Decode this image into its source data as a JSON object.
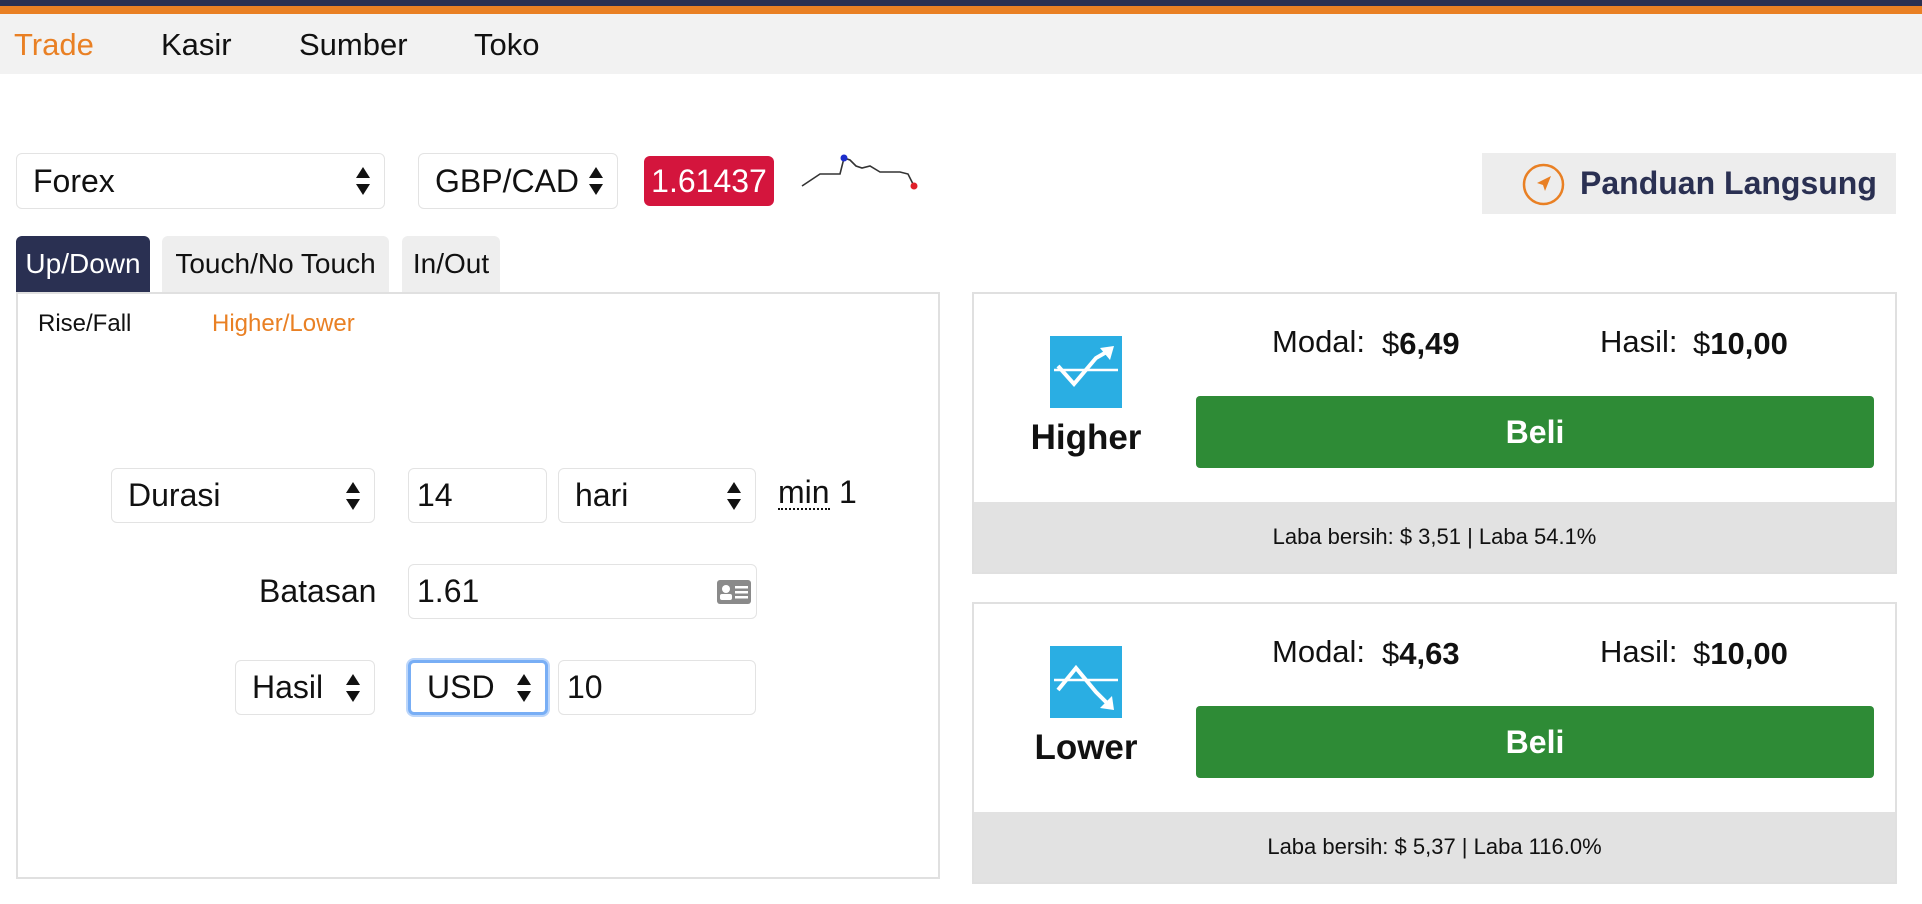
{
  "nav": {
    "items": [
      {
        "label": "Trade",
        "active": true
      },
      {
        "label": "Kasir",
        "active": false
      },
      {
        "label": "Sumber",
        "active": false
      },
      {
        "label": "Toko",
        "active": false
      }
    ]
  },
  "market": {
    "category": "Forex",
    "symbol": "GBP/CAD",
    "price": "1.61437",
    "price_color": "#d4153d"
  },
  "guide": {
    "label": "Panduan Langsung",
    "icon": "compass-icon"
  },
  "tabs": [
    {
      "label": "Up/Down",
      "active": true
    },
    {
      "label": "Touch/No Touch",
      "active": false
    },
    {
      "label": "In/Out",
      "active": false
    }
  ],
  "subtabs": [
    {
      "label": "Rise/Fall",
      "active": false
    },
    {
      "label": "Higher/Lower",
      "active": true
    }
  ],
  "form": {
    "duration_select": "Durasi",
    "duration_value": "14",
    "duration_unit": "hari",
    "min_label": "min",
    "min_value": "1",
    "barrier_label": "Batasan",
    "barrier_value": "1.61",
    "payout_select": "Hasil",
    "currency_select": "USD",
    "payout_value": "10"
  },
  "contracts": [
    {
      "name": "Higher",
      "icon": "trend-up-icon",
      "stake_label": "Modal:",
      "stake_currency": "$",
      "stake_value": "6,49",
      "payout_label": "Hasil:",
      "payout_currency": "$",
      "payout_value": "10,00",
      "buy_label": "Beli",
      "footer": "Laba bersih: $ 3,51 | Laba 54.1%"
    },
    {
      "name": "Lower",
      "icon": "trend-down-icon",
      "stake_label": "Modal:",
      "stake_currency": "$",
      "stake_value": "4,63",
      "payout_label": "Hasil:",
      "payout_currency": "$",
      "payout_value": "10,00",
      "buy_label": "Beli",
      "footer": "Laba bersih: $ 5,37 | Laba 116.0%"
    }
  ],
  "colors": {
    "accent_orange": "#e98024",
    "navy": "#2a3052",
    "buy_green": "#2e8b36",
    "icon_blue": "#2aaee3"
  }
}
